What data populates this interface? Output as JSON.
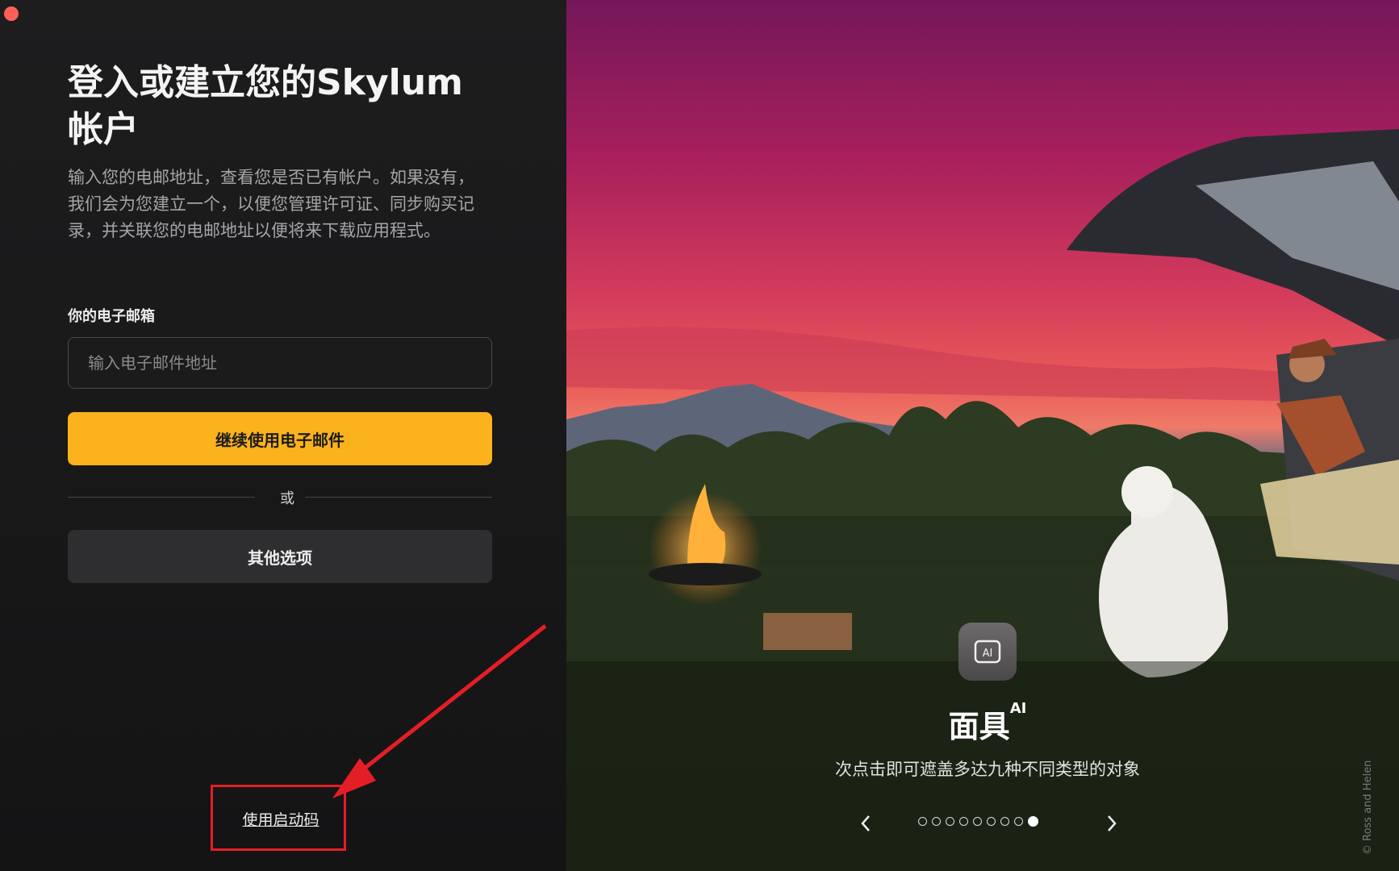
{
  "login": {
    "title": "登入或建立您的Skylum帐户",
    "description": "输入您的电邮地址，查看您是否已有帐户。如果没有，我们会为您建立一个，以便您管理许可证、同步购买记录，并关联您的电邮地址以便将来下载应用程式。",
    "email_label": "你的电子邮箱",
    "email_placeholder": "输入电子邮件地址",
    "email_value": "",
    "continue_button": "继续使用电子邮件",
    "or_text": "或",
    "other_options_button": "其他选项",
    "activation_link": "使用启动码"
  },
  "feature": {
    "icon": "ai-icon",
    "title": "面具",
    "title_superscript": "AI",
    "description": "次点击即可遮盖多达九种不同类型的对象",
    "carousel_total": 9,
    "carousel_active_index": 8,
    "credit": "© Ross and Helen"
  },
  "colors": {
    "accent": "#fbb21c",
    "annotation": "#e41e26",
    "window_close": "#ff5f57"
  }
}
